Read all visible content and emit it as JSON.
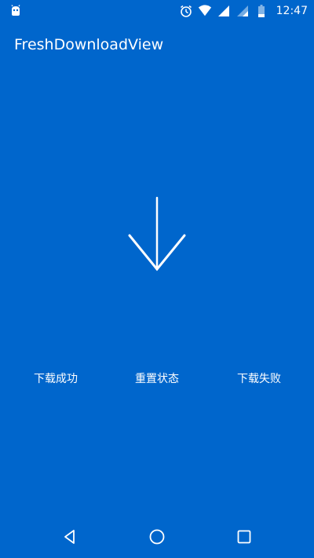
{
  "status_bar": {
    "time": "12:47",
    "icons": [
      "android-debug-icon",
      "alarm-icon",
      "wifi-icon",
      "cell-signal-icon",
      "cell-signal-2-icon",
      "battery-icon"
    ]
  },
  "toolbar": {
    "title": "FreshDownloadView"
  },
  "download_view": {
    "icon": "arrow-down-icon",
    "color": "#ffffff"
  },
  "actions": {
    "success_label": "下载成功",
    "reset_label": "重置状态",
    "fail_label": "下载失败"
  },
  "nav_bar": {
    "icons": [
      "back-icon",
      "home-icon",
      "recents-icon"
    ]
  },
  "colors": {
    "background": "#0066cc",
    "foreground": "#ffffff"
  }
}
